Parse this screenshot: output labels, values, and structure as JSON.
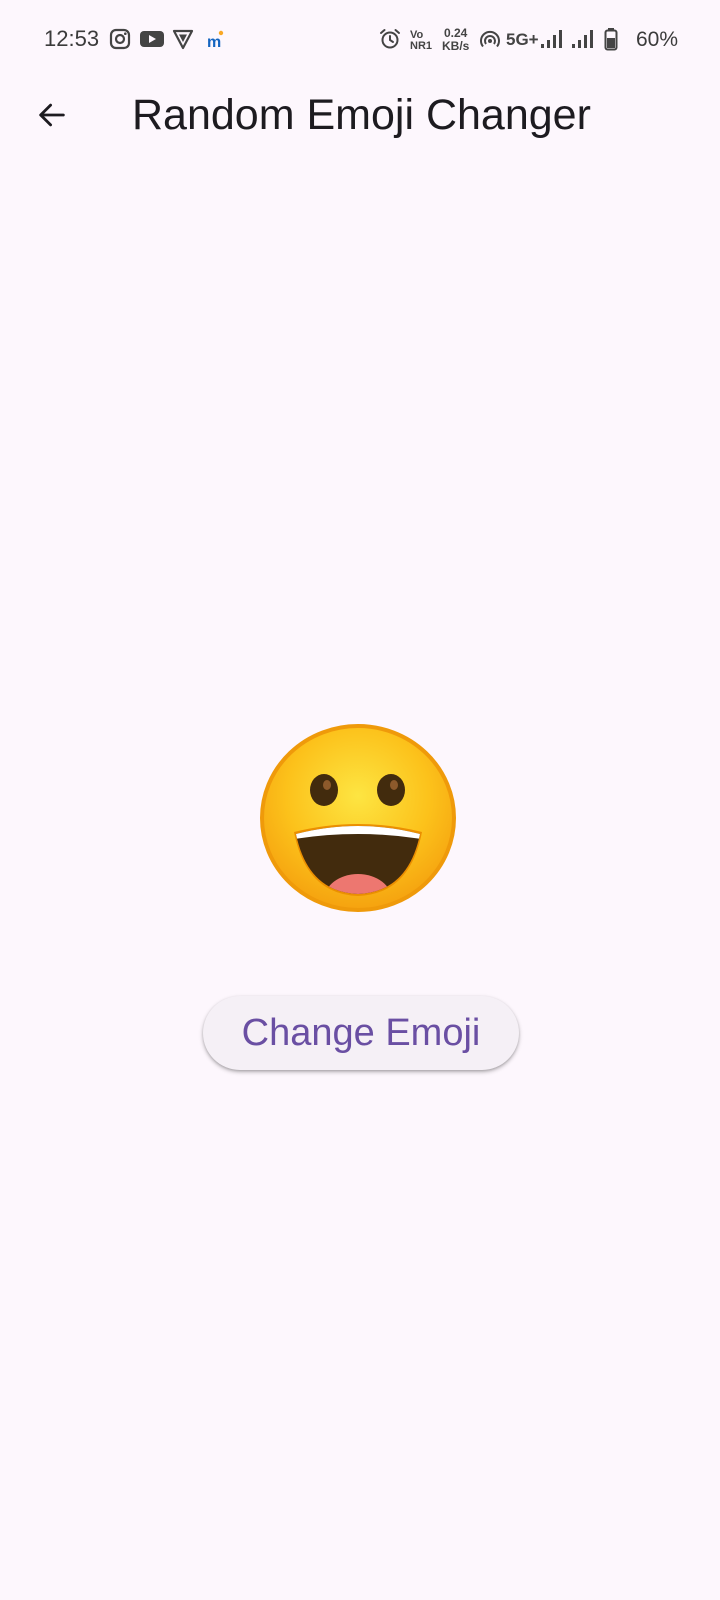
{
  "status_bar": {
    "time": "12:53",
    "network_speed_value": "0.24",
    "network_speed_unit": "KB/s",
    "volte_top": "Vo",
    "volte_bottom": "NR1",
    "network_type": "5G+",
    "battery": "60%",
    "icons": [
      "instagram-icon",
      "youtube-icon",
      "vpn-shield-icon",
      "app-notification-icon",
      "alarm-icon",
      "hotspot-icon",
      "signal-icon",
      "signal-icon",
      "battery-icon"
    ]
  },
  "app_bar": {
    "title": "Random Emoji Changer"
  },
  "main": {
    "emoji_name": "grinning-face",
    "button_label": "Change Emoji"
  },
  "colors": {
    "background": "#fdf7fd",
    "button_text": "#6a4fa3",
    "button_bg": "#f5f0f6"
  }
}
